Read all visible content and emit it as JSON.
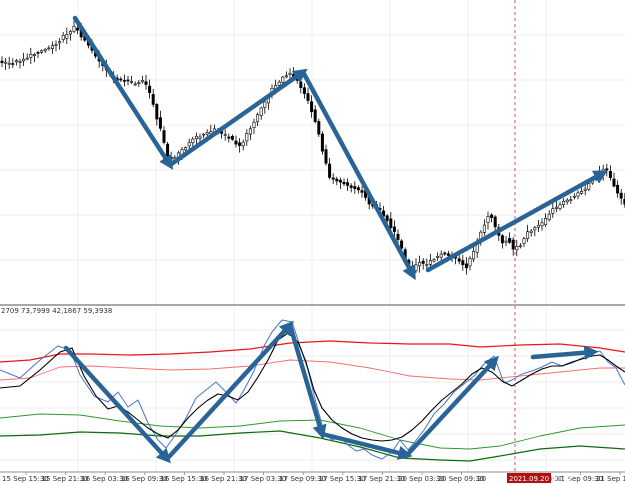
{
  "chart_data": {
    "type": "candlestick",
    "indicator_readout": "2709 73,7999 42,1867 59,3938",
    "x_ticks": [
      "15 Sep 15:30",
      "15 Sep 21:30",
      "16 Sep 03:30",
      "16 Sep 09:30",
      "16 Sep 15:30",
      "16 Sep 21:30",
      "17 Sep 03:30",
      "17 Sep 09:30",
      "17 Sep 15:30",
      "17 Sep 21:30",
      "20 Sep 03:30",
      "20 Sep 09:30",
      "20 Sep 15:30",
      "21 Sep 03:30",
      "21 Sep 09:30",
      "21 Sep 15:30"
    ],
    "cursor_label": "2021.09.20 20:00",
    "price_path": [
      [
        0,
        62
      ],
      [
        8,
        64
      ],
      [
        18,
        61
      ],
      [
        28,
        57
      ],
      [
        38,
        52
      ],
      [
        48,
        48
      ],
      [
        58,
        42
      ],
      [
        66,
        34
      ],
      [
        74,
        27
      ],
      [
        80,
        34
      ],
      [
        88,
        44
      ],
      [
        96,
        56
      ],
      [
        104,
        68
      ],
      [
        112,
        78
      ],
      [
        120,
        80
      ],
      [
        128,
        82
      ],
      [
        136,
        84
      ],
      [
        144,
        80
      ],
      [
        150,
        95
      ],
      [
        156,
        115
      ],
      [
        162,
        135
      ],
      [
        168,
        160
      ],
      [
        175,
        158
      ],
      [
        182,
        150
      ],
      [
        190,
        142
      ],
      [
        198,
        136
      ],
      [
        206,
        134
      ],
      [
        214,
        130
      ],
      [
        222,
        134
      ],
      [
        230,
        138
      ],
      [
        238,
        146
      ],
      [
        244,
        140
      ],
      [
        250,
        128
      ],
      [
        258,
        115
      ],
      [
        266,
        100
      ],
      [
        274,
        86
      ],
      [
        282,
        78
      ],
      [
        290,
        74
      ],
      [
        298,
        82
      ],
      [
        306,
        96
      ],
      [
        312,
        112
      ],
      [
        318,
        130
      ],
      [
        324,
        158
      ],
      [
        330,
        178
      ],
      [
        338,
        180
      ],
      [
        346,
        184
      ],
      [
        354,
        188
      ],
      [
        362,
        192
      ],
      [
        370,
        204
      ],
      [
        378,
        208
      ],
      [
        386,
        218
      ],
      [
        394,
        232
      ],
      [
        400,
        245
      ],
      [
        406,
        262
      ],
      [
        412,
        270
      ],
      [
        418,
        262
      ],
      [
        424,
        264
      ],
      [
        430,
        262
      ],
      [
        436,
        257
      ],
      [
        442,
        252
      ],
      [
        450,
        255
      ],
      [
        458,
        260
      ],
      [
        466,
        268
      ],
      [
        472,
        255
      ],
      [
        478,
        240
      ],
      [
        484,
        225
      ],
      [
        490,
        212
      ],
      [
        496,
        230
      ],
      [
        502,
        243
      ],
      [
        508,
        238
      ],
      [
        514,
        250
      ],
      [
        520,
        245
      ],
      [
        528,
        232
      ],
      [
        536,
        228
      ],
      [
        544,
        222
      ],
      [
        552,
        210
      ],
      [
        560,
        205
      ],
      [
        568,
        200
      ],
      [
        576,
        195
      ],
      [
        584,
        190
      ],
      [
        592,
        180
      ],
      [
        600,
        172
      ],
      [
        606,
        168
      ],
      [
        612,
        182
      ],
      [
        618,
        195
      ],
      [
        625,
        205
      ]
    ],
    "indicator": {
      "upper_band": [
        [
          0,
          362
        ],
        [
          30,
          360
        ],
        [
          60,
          354
        ],
        [
          90,
          354
        ],
        [
          130,
          355
        ],
        [
          170,
          354
        ],
        [
          210,
          352
        ],
        [
          250,
          349
        ],
        [
          290,
          343
        ],
        [
          330,
          341
        ],
        [
          370,
          343
        ],
        [
          410,
          344
        ],
        [
          450,
          344
        ],
        [
          480,
          347
        ],
        [
          520,
          345
        ],
        [
          560,
          344
        ],
        [
          600,
          348
        ],
        [
          625,
          352
        ]
      ],
      "upper_mid": [
        [
          0,
          380
        ],
        [
          30,
          378
        ],
        [
          60,
          367
        ],
        [
          90,
          366
        ],
        [
          130,
          368
        ],
        [
          170,
          370
        ],
        [
          210,
          369
        ],
        [
          250,
          366
        ],
        [
          290,
          360
        ],
        [
          330,
          362
        ],
        [
          370,
          368
        ],
        [
          410,
          376
        ],
        [
          450,
          379
        ],
        [
          480,
          380
        ],
        [
          520,
          376
        ],
        [
          560,
          372
        ],
        [
          600,
          368
        ],
        [
          625,
          368
        ]
      ],
      "lower_mid": [
        [
          0,
          418
        ],
        [
          40,
          414
        ],
        [
          80,
          415
        ],
        [
          120,
          421
        ],
        [
          160,
          426
        ],
        [
          200,
          428
        ],
        [
          240,
          426
        ],
        [
          280,
          421
        ],
        [
          320,
          420
        ],
        [
          360,
          428
        ],
        [
          400,
          440
        ],
        [
          440,
          448
        ],
        [
          470,
          449
        ],
        [
          500,
          446
        ],
        [
          540,
          436
        ],
        [
          580,
          428
        ],
        [
          625,
          425
        ]
      ],
      "lower_band": [
        [
          0,
          436
        ],
        [
          40,
          435
        ],
        [
          80,
          432
        ],
        [
          120,
          433
        ],
        [
          160,
          436
        ],
        [
          200,
          436
        ],
        [
          240,
          433
        ],
        [
          280,
          431
        ],
        [
          320,
          438
        ],
        [
          360,
          447
        ],
        [
          400,
          458
        ],
        [
          440,
          460
        ],
        [
          470,
          461
        ],
        [
          500,
          456
        ],
        [
          540,
          449
        ],
        [
          580,
          446
        ],
        [
          625,
          449
        ]
      ],
      "fast_line": [
        [
          0,
          370
        ],
        [
          20,
          378
        ],
        [
          40,
          360
        ],
        [
          58,
          346
        ],
        [
          70,
          350
        ],
        [
          80,
          375
        ],
        [
          94,
          396
        ],
        [
          108,
          402
        ],
        [
          118,
          392
        ],
        [
          128,
          407
        ],
        [
          138,
          400
        ],
        [
          148,
          423
        ],
        [
          158,
          440
        ],
        [
          166,
          448
        ],
        [
          176,
          434
        ],
        [
          186,
          418
        ],
        [
          196,
          398
        ],
        [
          206,
          390
        ],
        [
          216,
          382
        ],
        [
          226,
          392
        ],
        [
          236,
          403
        ],
        [
          244,
          390
        ],
        [
          254,
          371
        ],
        [
          264,
          346
        ],
        [
          272,
          332
        ],
        [
          282,
          320
        ],
        [
          292,
          322
        ],
        [
          300,
          346
        ],
        [
          308,
          370
        ],
        [
          316,
          403
        ],
        [
          324,
          432
        ],
        [
          332,
          440
        ],
        [
          340,
          437
        ],
        [
          348,
          445
        ],
        [
          356,
          451
        ],
        [
          364,
          449
        ],
        [
          372,
          455
        ],
        [
          382,
          459
        ],
        [
          392,
          452
        ],
        [
          400,
          440
        ],
        [
          408,
          450
        ],
        [
          414,
          443
        ],
        [
          424,
          430
        ],
        [
          434,
          414
        ],
        [
          444,
          404
        ],
        [
          454,
          392
        ],
        [
          464,
          384
        ],
        [
          474,
          376
        ],
        [
          484,
          364
        ],
        [
          494,
          356
        ],
        [
          504,
          383
        ],
        [
          512,
          380
        ],
        [
          522,
          374
        ],
        [
          532,
          371
        ],
        [
          542,
          367
        ],
        [
          552,
          362
        ],
        [
          562,
          366
        ],
        [
          572,
          363
        ],
        [
          582,
          358
        ],
        [
          592,
          353
        ],
        [
          600,
          351
        ],
        [
          608,
          362
        ],
        [
          616,
          368
        ],
        [
          625,
          385
        ]
      ],
      "slow_line": [
        [
          0,
          388
        ],
        [
          20,
          386
        ],
        [
          40,
          370
        ],
        [
          60,
          352
        ],
        [
          72,
          348
        ],
        [
          84,
          376
        ],
        [
          96,
          396
        ],
        [
          108,
          409
        ],
        [
          118,
          406
        ],
        [
          128,
          412
        ],
        [
          138,
          420
        ],
        [
          148,
          428
        ],
        [
          158,
          434
        ],
        [
          168,
          438
        ],
        [
          178,
          430
        ],
        [
          188,
          418
        ],
        [
          198,
          408
        ],
        [
          208,
          400
        ],
        [
          218,
          394
        ],
        [
          228,
          396
        ],
        [
          238,
          400
        ],
        [
          248,
          392
        ],
        [
          258,
          377
        ],
        [
          268,
          360
        ],
        [
          278,
          340
        ],
        [
          288,
          333
        ],
        [
          298,
          342
        ],
        [
          306,
          362
        ],
        [
          314,
          390
        ],
        [
          322,
          408
        ],
        [
          332,
          420
        ],
        [
          342,
          428
        ],
        [
          352,
          434
        ],
        [
          362,
          438
        ],
        [
          372,
          440
        ],
        [
          382,
          441
        ],
        [
          392,
          440
        ],
        [
          402,
          437
        ],
        [
          412,
          430
        ],
        [
          422,
          421
        ],
        [
          432,
          410
        ],
        [
          442,
          400
        ],
        [
          452,
          392
        ],
        [
          462,
          384
        ],
        [
          472,
          374
        ],
        [
          482,
          368
        ],
        [
          492,
          372
        ],
        [
          502,
          381
        ],
        [
          512,
          386
        ],
        [
          522,
          380
        ],
        [
          532,
          374
        ],
        [
          542,
          369
        ],
        [
          552,
          366
        ],
        [
          562,
          366
        ],
        [
          572,
          362
        ],
        [
          582,
          359
        ],
        [
          592,
          356
        ],
        [
          600,
          355
        ],
        [
          608,
          360
        ],
        [
          616,
          366
        ],
        [
          625,
          372
        ]
      ]
    },
    "annotation_arrows": [
      {
        "panel": "price",
        "from": [
          75,
          18
        ],
        "to": [
          170,
          165
        ]
      },
      {
        "panel": "price",
        "from": [
          170,
          165
        ],
        "to": [
          303,
          72
        ]
      },
      {
        "panel": "price",
        "from": [
          303,
          72
        ],
        "to": [
          413,
          275
        ]
      },
      {
        "panel": "price",
        "from": [
          428,
          270
        ],
        "to": [
          603,
          173
        ]
      },
      {
        "panel": "indicator",
        "from": [
          66,
          348
        ],
        "to": [
          167,
          459
        ]
      },
      {
        "panel": "indicator",
        "from": [
          167,
          459
        ],
        "to": [
          290,
          325
        ]
      },
      {
        "panel": "indicator",
        "from": [
          290,
          325
        ],
        "to": [
          322,
          434
        ]
      },
      {
        "panel": "indicator",
        "from": [
          322,
          434
        ],
        "to": [
          407,
          455
        ]
      },
      {
        "panel": "indicator",
        "from": [
          407,
          455
        ],
        "to": [
          495,
          360
        ]
      },
      {
        "panel": "indicator",
        "from": [
          533,
          357
        ],
        "to": [
          593,
          352
        ]
      }
    ],
    "colors": {
      "candle": "#000000",
      "grid": "#e8e8e8",
      "upper_band": "#e8151b",
      "upper_mid": "#f07070",
      "lower_mid": "#2a9a2a",
      "lower_band": "#0d6b0d",
      "fast_line": "#4a73c8",
      "slow_line": "#000000",
      "arrow": "#2a6496",
      "cursor": "#c03030",
      "cursor_label_bg": "#b01010"
    }
  }
}
